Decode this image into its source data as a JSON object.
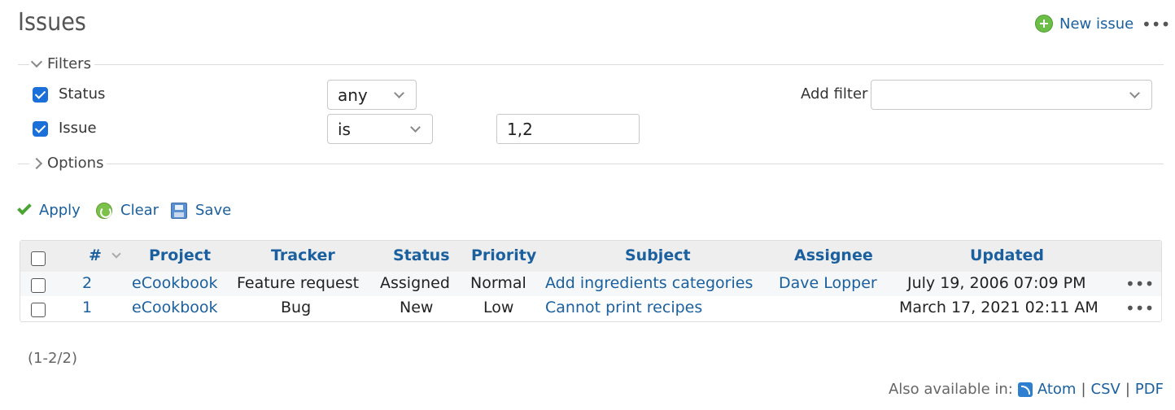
{
  "header": {
    "title": "Issues",
    "new_issue_label": "New issue",
    "more_label": "•••"
  },
  "filters": {
    "legend": "Filters",
    "rows": [
      {
        "label": "Status",
        "checked": true,
        "operator": "any",
        "value": ""
      },
      {
        "label": "Issue",
        "checked": true,
        "operator": "is",
        "value": "1,2"
      }
    ],
    "add_filter_label": "Add filter",
    "add_filter_value": ""
  },
  "options": {
    "legend": "Options"
  },
  "actions": {
    "apply": "Apply",
    "clear": "Clear",
    "save": "Save"
  },
  "table": {
    "columns": [
      "#",
      "Project",
      "Tracker",
      "Status",
      "Priority",
      "Subject",
      "Assignee",
      "Updated"
    ],
    "rows": [
      {
        "id": "2",
        "project": "eCookbook",
        "tracker": "Feature request",
        "status": "Assigned",
        "priority": "Normal",
        "subject": "Add ingredients categories",
        "assignee": "Dave Lopper",
        "updated": "July 19, 2006 07:09 PM",
        "more": "•••"
      },
      {
        "id": "1",
        "project": "eCookbook",
        "tracker": "Bug",
        "status": "New",
        "priority": "Low",
        "subject": "Cannot print recipes",
        "assignee": "",
        "updated": "March 17, 2021 02:11 AM",
        "more": "•••"
      }
    ]
  },
  "pagination": "(1-2/2)",
  "other_formats": {
    "label": "Also available in:",
    "atom": "Atom",
    "csv": "CSV",
    "pdf": "PDF",
    "separator": "|"
  },
  "colors": {
    "link": "#1a5f9e",
    "checkbox": "#1a6fd9",
    "apply_check": "#4aa534"
  }
}
